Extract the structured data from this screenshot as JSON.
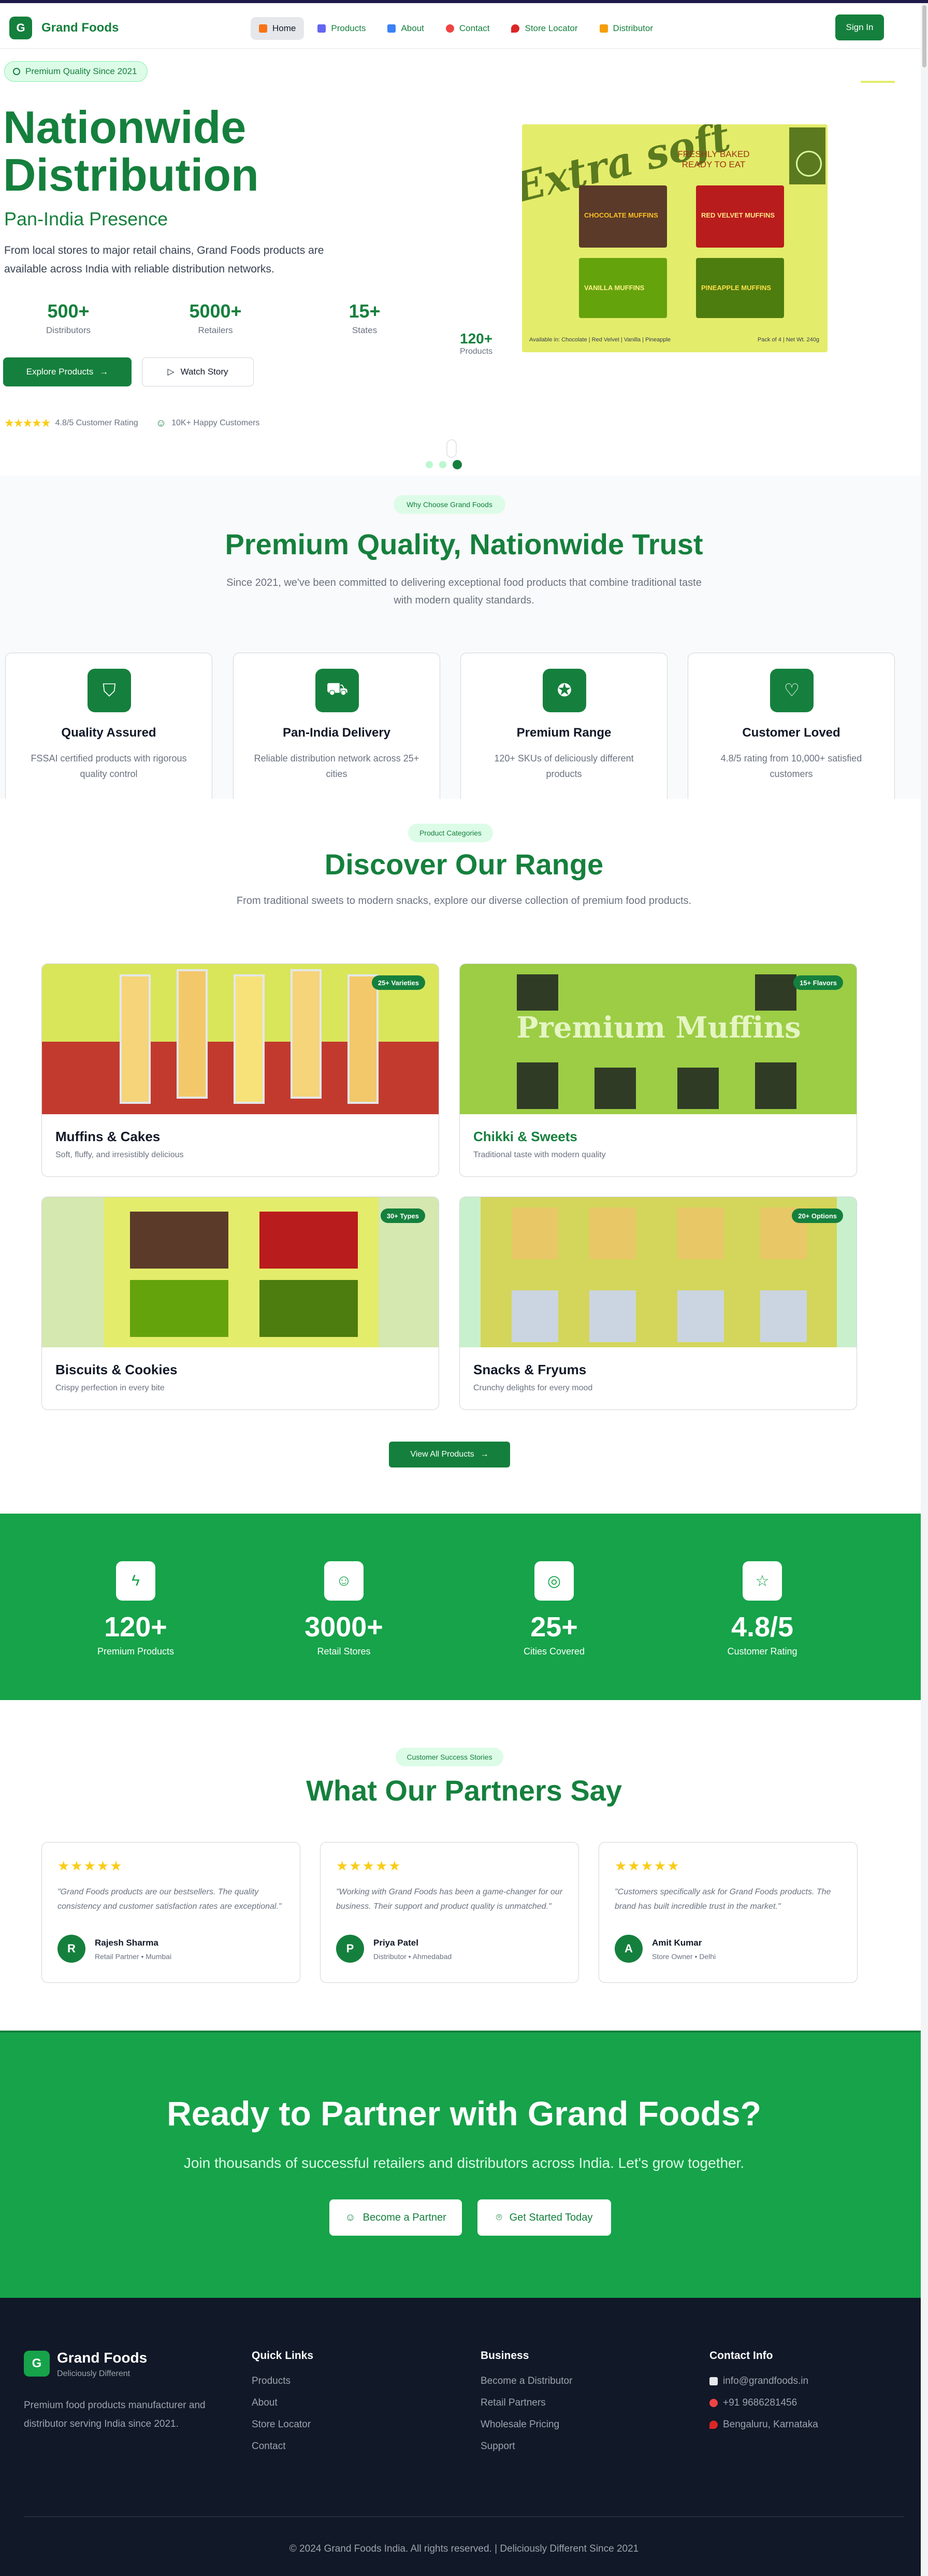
{
  "brand": {
    "logo_letter": "G",
    "name": "Grand Foods",
    "primary": "#15803d",
    "accent": "#16a34a"
  },
  "nav": {
    "links": [
      {
        "label": "Home",
        "icon": "home-icon"
      },
      {
        "label": "Products",
        "icon": "products-icon"
      },
      {
        "label": "About",
        "icon": "about-icon"
      },
      {
        "label": "Contact",
        "icon": "phone-icon"
      },
      {
        "label": "Store Locator",
        "icon": "map-pin-icon"
      },
      {
        "label": "Distributor",
        "icon": "handshake-icon"
      }
    ],
    "signin": "Sign In"
  },
  "hero": {
    "badge": "Premium Quality Since 2021",
    "title_line1": "Nationwide",
    "title_line2": "Distribution",
    "subtitle": "Pan-India Presence",
    "description": "From local stores to major retail chains, Grand Foods products are available across India with reliable distribution networks.",
    "stats": [
      {
        "value": "500+",
        "label": "Distributors"
      },
      {
        "value": "5000+",
        "label": "Retailers"
      },
      {
        "value": "15+",
        "label": "States"
      }
    ],
    "explore_btn": "Explore Products",
    "watch_btn": "Watch Story",
    "rating": "4.8/5 Customer Rating",
    "customers": "10K+ Happy Customers",
    "side_stat": {
      "value": "120+",
      "label": "Products"
    },
    "image": {
      "script": "Extra soft",
      "fresh": "FRESHLY BAKED READY TO EAT",
      "boxes": [
        "CHOCOLATE MUFFINS",
        "RED VELVET MUFFINS",
        "VANILLA MUFFINS",
        "PINEAPPLE MUFFINS"
      ],
      "foot_left": "Available in: Chocolate | Red Velvet | Vanilla | Pineapple",
      "foot_right": "Pack of 4 | Net Wt. 240g"
    }
  },
  "why": {
    "pill": "Why Choose Grand Foods",
    "title": "Premium Quality, Nationwide Trust",
    "desc": "Since 2021, we've been committed to delivering exceptional food products that combine traditional taste with modern quality standards.",
    "features": [
      {
        "icon": "shield-icon",
        "title": "Quality Assured",
        "desc": "FSSAI certified products with rigorous quality control"
      },
      {
        "icon": "truck-icon",
        "title": "Pan-India Delivery",
        "desc": "Reliable distribution network across 25+ cities"
      },
      {
        "icon": "award-icon",
        "title": "Premium Range",
        "desc": "120+ SKUs of deliciously different products"
      },
      {
        "icon": "heart-icon",
        "title": "Customer Loved",
        "desc": "4.8/5 rating from 10,000+ satisfied customers"
      }
    ]
  },
  "range": {
    "pill": "Product Categories",
    "title": "Discover Our Range",
    "desc": "From traditional sweets to modern snacks, explore our diverse collection of premium food products.",
    "categories": [
      {
        "name": "Muffins & Cakes",
        "desc": "Soft, fluffy, and irresistibly delicious",
        "tag": "25+ Varieties"
      },
      {
        "name": "Chikki & Sweets",
        "desc": "Traditional taste with modern quality",
        "tag": "15+ Flavors",
        "banner": "Premium Muffins"
      },
      {
        "name": "Biscuits & Cookies",
        "desc": "Crispy perfection in every bite",
        "tag": "30+ Types"
      },
      {
        "name": "Snacks & Fryums",
        "desc": "Crunchy delights for every mood",
        "tag": "20+ Options"
      }
    ],
    "view_all": "View All Products"
  },
  "band": {
    "stats": [
      {
        "icon": "bolt-icon",
        "value": "120+",
        "label": "Premium Products"
      },
      {
        "icon": "users-icon",
        "value": "3000+",
        "label": "Retail Stores"
      },
      {
        "icon": "globe-icon",
        "value": "25+",
        "label": "Cities Covered"
      },
      {
        "icon": "star-icon",
        "value": "4.8/5",
        "label": "Customer Rating"
      }
    ]
  },
  "testimonials": {
    "pill": "Customer Success Stories",
    "title": "What Our Partners Say",
    "stars": "★★★★★",
    "items": [
      {
        "quote": "\"Grand Foods products are our bestsellers. The quality consistency and customer satisfaction rates are exceptional.\"",
        "initial": "R",
        "name": "Rajesh Sharma",
        "role": "Retail Partner • Mumbai"
      },
      {
        "quote": "\"Working with Grand Foods has been a game-changer for our business. Their support and product quality is unmatched.\"",
        "initial": "P",
        "name": "Priya Patel",
        "role": "Distributor • Ahmedabad"
      },
      {
        "quote": "\"Customers specifically ask for Grand Foods products. The brand has built incredible trust in the market.\"",
        "initial": "A",
        "name": "Amit Kumar",
        "role": "Store Owner • Delhi"
      }
    ]
  },
  "cta": {
    "title": "Ready to Partner with Grand Foods?",
    "desc": "Join thousands of successful retailers and distributors across India. Let's grow together.",
    "btn_partner": "Become a Partner",
    "btn_start": "Get Started Today"
  },
  "footer": {
    "name": "Grand Foods",
    "tagline": "Deliciously Different",
    "desc": "Premium food products manufacturer and distributor serving India since 2021.",
    "quick_title": "Quick Links",
    "quick": [
      "Products",
      "About",
      "Store Locator",
      "Contact"
    ],
    "biz_title": "Business",
    "biz": [
      "Become a Distributor",
      "Retail Partners",
      "Wholesale Pricing",
      "Support"
    ],
    "contact_title": "Contact Info",
    "email": "info@grandfoods.in",
    "phone": "+91 9686281456",
    "location": "Bengaluru, Karnataka",
    "copyright": "© 2024 Grand Foods India. All rights reserved. | Deliciously Different Since 2021"
  }
}
